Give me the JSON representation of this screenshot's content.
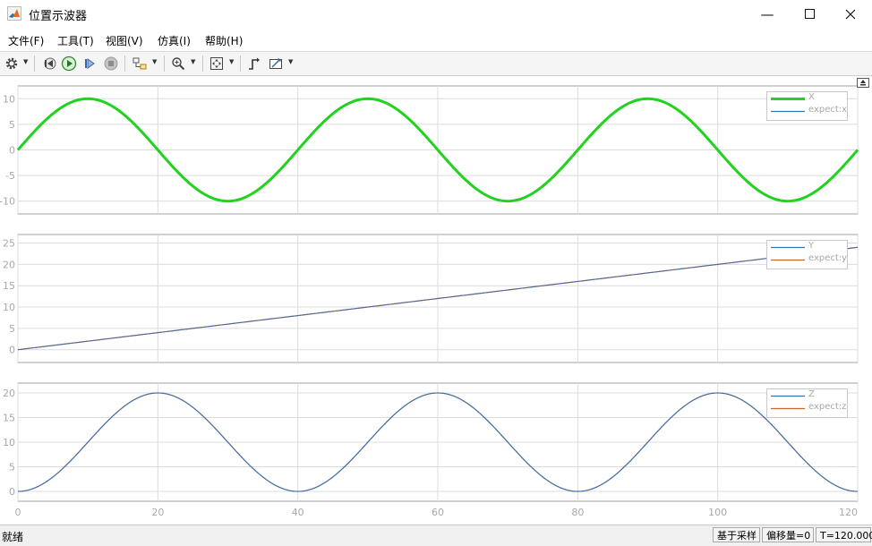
{
  "window": {
    "title": "位置示波器"
  },
  "menu": [
    "文件(F)",
    "工具(T)",
    "视图(V)",
    "仿真(I)",
    "帮助(H)"
  ],
  "toolbar_icons": [
    "gear-icon",
    "step-back-icon",
    "run-icon",
    "step-forward-icon",
    "stop-icon",
    "signal-select-icon",
    "zoom-icon",
    "fit-to-view-icon",
    "triggers-icon",
    "measurements-icon"
  ],
  "status": {
    "text": "就绪",
    "sample_mode": "基于采样",
    "offset": "偏移量=0",
    "time": "T=120.000"
  },
  "colors": {
    "x_signal": "#21d21e",
    "blue": "#3f6fa8",
    "orange": "#d2642a",
    "grid": "#dcdcdc",
    "tick": "#a8a8a8"
  },
  "chart_data": [
    {
      "type": "line",
      "xlim": [
        0,
        120
      ],
      "ylim": [
        -12.5,
        12.5
      ],
      "xticks": [
        0,
        20,
        40,
        60,
        80,
        100,
        120
      ],
      "yticks": [
        10,
        5,
        0,
        -5,
        -10
      ],
      "legend": [
        "X",
        "expect:x"
      ],
      "legend_position": "top-right",
      "grid": true,
      "series": [
        {
          "name": "X",
          "function": "10*sin(2*pi*t/40)",
          "x": [
            0,
            10,
            20,
            30,
            40,
            50,
            60,
            70,
            80,
            90,
            100,
            110,
            120
          ],
          "y": [
            0,
            10,
            0,
            -10,
            0,
            10,
            0,
            -10,
            0,
            10,
            0,
            -10,
            0
          ]
        },
        {
          "name": "expect:x",
          "function": "10*sin(2*pi*t/40)",
          "x": [
            0,
            10,
            20,
            30,
            40,
            50,
            60,
            70,
            80,
            90,
            100,
            110,
            120
          ],
          "y": [
            0,
            10,
            0,
            -10,
            0,
            10,
            0,
            -10,
            0,
            10,
            0,
            -10,
            0
          ]
        }
      ]
    },
    {
      "type": "line",
      "xlim": [
        0,
        120
      ],
      "ylim": [
        -3,
        27
      ],
      "xticks": [
        0,
        20,
        40,
        60,
        80,
        100,
        120
      ],
      "yticks": [
        25,
        20,
        15,
        10,
        5,
        0
      ],
      "legend": [
        "Y",
        "expect:y"
      ],
      "legend_position": "top-right",
      "grid": true,
      "series": [
        {
          "name": "Y",
          "function": "0.2*t",
          "x": [
            0,
            120
          ],
          "y": [
            0,
            24
          ]
        },
        {
          "name": "expect:y",
          "function": "0.2*t",
          "x": [
            0,
            120
          ],
          "y": [
            0,
            24
          ]
        }
      ]
    },
    {
      "type": "line",
      "xlim": [
        0,
        120
      ],
      "ylim": [
        -2,
        22
      ],
      "xticks": [
        0,
        20,
        40,
        60,
        80,
        100,
        120
      ],
      "xtick_labels": [
        "0",
        "20",
        "40",
        "60",
        "80",
        "100",
        "120"
      ],
      "yticks": [
        20,
        15,
        10,
        5,
        0
      ],
      "legend": [
        "Z",
        "expect:z"
      ],
      "legend_position": "top-right",
      "grid": true,
      "series": [
        {
          "name": "Z",
          "function": "10-10*cos(2*pi*t/40)",
          "x": [
            0,
            20,
            40,
            60,
            80,
            100,
            120
          ],
          "y": [
            0,
            20,
            0,
            20,
            0,
            20,
            0
          ]
        },
        {
          "name": "expect:z",
          "function": "10-10*cos(2*pi*t/40)",
          "x": [
            0,
            20,
            40,
            60,
            80,
            100,
            120
          ],
          "y": [
            0,
            20,
            0,
            20,
            0,
            20,
            0
          ]
        }
      ]
    }
  ]
}
